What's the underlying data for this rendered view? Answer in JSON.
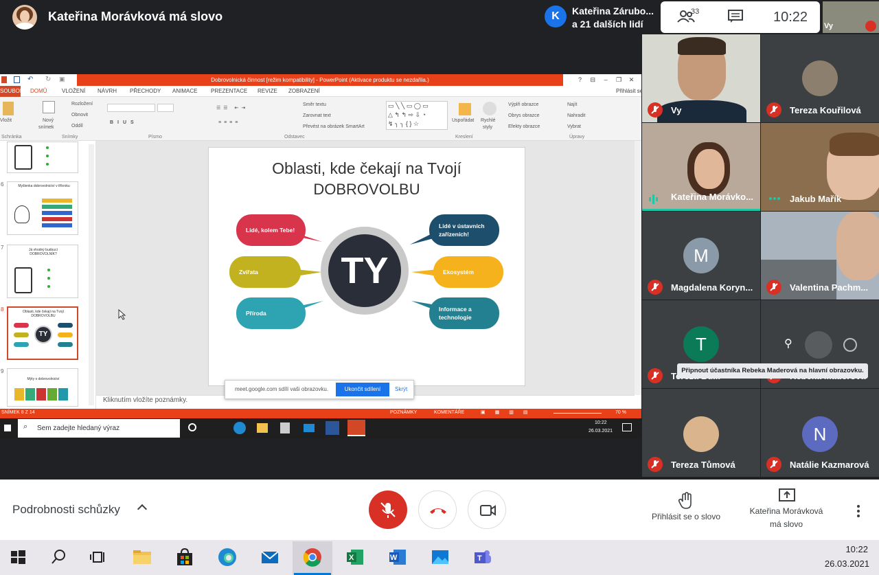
{
  "topbar": {
    "presenter_title": "Kateřina Morávková má slovo",
    "speaker_initial": "K",
    "speaker_name": "Kateřina Zárubo...",
    "speaker_others": "a 21 dalších lidí",
    "people_count": "33",
    "clock": "10:22",
    "self_label": "Vy"
  },
  "ppt": {
    "title_bar": "Dobrovolnická činnost [režim kompatibility] - PowerPoint (Aktivace produktu se nezdařila.)",
    "tabs": [
      "SOUBOR",
      "DOMŮ",
      "VLOŽENÍ",
      "NÁVRH",
      "PŘECHODY",
      "ANIMACE",
      "PREZENTACE",
      "REVIZE",
      "ZOBRAZENÍ"
    ],
    "share_label": "Přihlásit se",
    "ribbon": {
      "vlozit": "Vložit",
      "novy": "Nový",
      "snimek": "snímek",
      "rozlozeni": "Rozložení",
      "obnovit": "Obnovit",
      "oddil": "Oddíl",
      "smer": "Směr textu",
      "zarovnat": "Zarovnat text",
      "prevest": "Převést na obrázek SmartArt",
      "usporadat": "Uspořádat",
      "rychle": "Rychlé",
      "styly": "styly",
      "vypln": "Výplň obrazce",
      "obrys": "Obrys obrazce",
      "efekty": "Efekty obrazce",
      "najit": "Najít",
      "nahradit": "Nahradit",
      "vybrat": "Vybrat",
      "groups": [
        "Schránka",
        "Snímky",
        "Písmo",
        "Odstavec",
        "Kreslení",
        "Úpravy"
      ]
    },
    "thumbs": [
      {
        "num": "",
        "title": ""
      },
      {
        "num": "6",
        "title": "Myšlenka dobrovolnictví v tříkroku"
      },
      {
        "num": "7",
        "title": "Já vhodný budoucí DOBROVOLNÍK?"
      },
      {
        "num": "8",
        "title": "Oblasti, kde čekají na Tvojí DOBROVOLBU"
      },
      {
        "num": "9",
        "title": "Mýty o dobrovolnictví"
      }
    ],
    "slide": {
      "title_line1": "Oblasti, kde čekají na Tvojí",
      "title_line2": "DOBROVOLBU",
      "hub": "TY",
      "bubbles": [
        {
          "text": "Lidé, kolem Tebe!",
          "color": "#d8354d"
        },
        {
          "text": "Zvířata",
          "color": "#c3b220"
        },
        {
          "text": "Příroda",
          "color": "#2ea3b1"
        },
        {
          "text": "Lidé v ústavních zařízeních!",
          "color": "#1d4f6d"
        },
        {
          "text": "Ekosystém",
          "color": "#f6b21c"
        },
        {
          "text": "Informace a technologie",
          "color": "#238091"
        }
      ]
    },
    "notes": "Kliknutím vložíte poznámky.",
    "share_bar": {
      "text": "meet.google.com sdílí vaši obrazovku.",
      "stop": "Ukončit sdílení",
      "hide": "Skrýt"
    },
    "status": {
      "slide": "SNÍMEK 8 Z 14",
      "notes": "POZNÁMKY",
      "comments": "KOMENTÁŘE",
      "zoom": "70 %"
    },
    "inner_taskbar": {
      "search": "Sem zadejte hledaný výraz",
      "time": "10:22",
      "date": "26.03.2021"
    }
  },
  "participants": [
    {
      "name": "Vy",
      "muted": true
    },
    {
      "name": "Tereza Kouřilová",
      "muted": true
    },
    {
      "name": "Kateřina Morávko...",
      "muted": false
    },
    {
      "name": "Jakub Mařík",
      "muted": false
    },
    {
      "name": "Magdalena Koryn...",
      "muted": true,
      "initial": "M",
      "color": "#8a9aa8"
    },
    {
      "name": "Valentina Pachm...",
      "muted": true
    },
    {
      "name": "Tereza Bu...",
      "muted": true,
      "initial": "T",
      "color": "#0b7a57"
    },
    {
      "name": "Rebeka Maderová",
      "muted": true
    },
    {
      "name": "Tereza Tůmová",
      "muted": true
    },
    {
      "name": "Natálie Kazmarová",
      "muted": true,
      "initial": "N",
      "color": "#5c6bc0"
    }
  ],
  "tooltip": "Připnout účastníka Rebeka Maderová na hlavní obrazovku.",
  "bottombar": {
    "meeting_details": "Podrobnosti schůzky",
    "raise_hand": "Přihlásit se o slovo",
    "present_line1": "Kateřina Morávková",
    "present_line2": "má slovo"
  },
  "taskbar": {
    "time": "10:22",
    "date": "26.03.2021"
  },
  "colors": {
    "end_call": "#ffffff",
    "mute_red": "#d93025",
    "ppt_red": "#e8411a",
    "meet_dark": "#202124"
  }
}
